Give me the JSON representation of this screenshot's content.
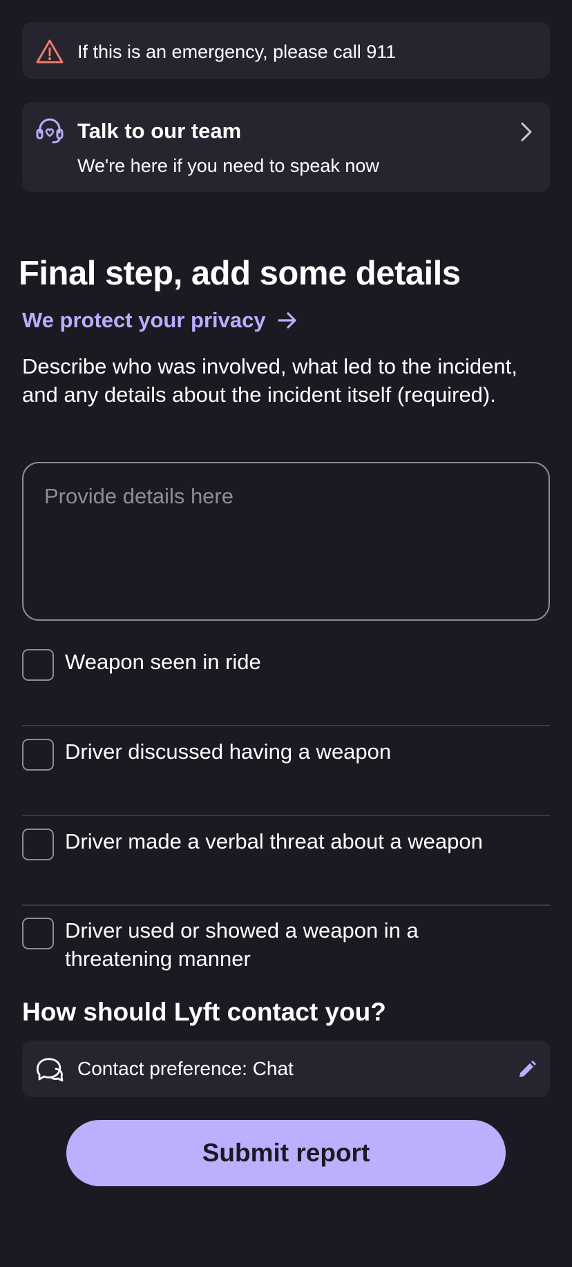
{
  "emergency": {
    "icon": "warning-triangle-icon",
    "text": "If this is an emergency, please call 911",
    "icon_color": "#f07a68"
  },
  "team": {
    "icon": "support-headset-icon",
    "title": "Talk to our team",
    "subtitle": "We're here if you need to speak now",
    "chevron": "chevron-right-icon"
  },
  "details": {
    "heading": "Final step, add some details",
    "privacy_link": "We protect your privacy",
    "privacy_icon": "arrow-right-icon",
    "description": "Describe who was involved, what led to the incident, and any details about the incident itself (required).",
    "placeholder": "Provide details here",
    "value": ""
  },
  "checkboxes": [
    {
      "label": "Weapon seen in ride",
      "checked": false
    },
    {
      "label": "Driver discussed having a weapon",
      "checked": false
    },
    {
      "label": "Driver made a verbal threat about a weapon",
      "checked": false
    },
    {
      "label": "Driver used or showed a weapon in a threatening manner",
      "checked": false
    }
  ],
  "contact": {
    "heading": "How should Lyft contact you?",
    "icon": "chat-bubbles-icon",
    "preference_text": "Contact preference: Chat",
    "edit_icon": "pencil-icon"
  },
  "submit_label": "Submit report",
  "colors": {
    "background": "#1b1a22",
    "card": "#26252f",
    "accent": "#bbb0fd",
    "warning": "#f07a68"
  }
}
